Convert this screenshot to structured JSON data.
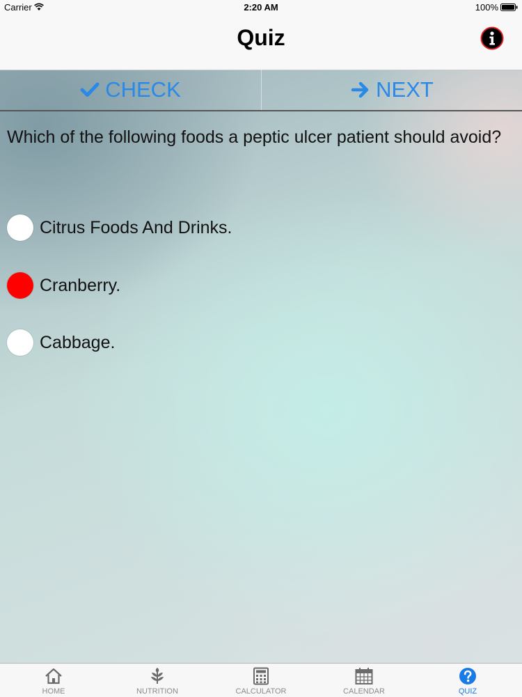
{
  "status": {
    "carrier": "Carrier",
    "time": "2:20 AM",
    "battery": "100%"
  },
  "navbar": {
    "title": "Quiz",
    "info_icon": "info-icon"
  },
  "actions": {
    "check_label": "CHECK",
    "next_label": "NEXT",
    "color": "#2a88e6"
  },
  "quiz": {
    "question": "Which of the following foods a peptic ulcer patient should avoid?",
    "options": [
      {
        "label": "Citrus Foods And Drinks.",
        "selected": false
      },
      {
        "label": "Cranberry.",
        "selected": true
      },
      {
        "label": "Cabbage.",
        "selected": false
      }
    ],
    "selected_color": "#ff0000"
  },
  "tabs": [
    {
      "label": "HOME",
      "icon": "home-icon",
      "active": false
    },
    {
      "label": "NUTRITION",
      "icon": "leaf-icon",
      "active": false
    },
    {
      "label": "CALCULATOR",
      "icon": "calculator-icon",
      "active": false
    },
    {
      "label": "CALENDAR",
      "icon": "calendar-icon",
      "active": false
    },
    {
      "label": "QUIZ",
      "icon": "question-icon",
      "active": true
    }
  ]
}
